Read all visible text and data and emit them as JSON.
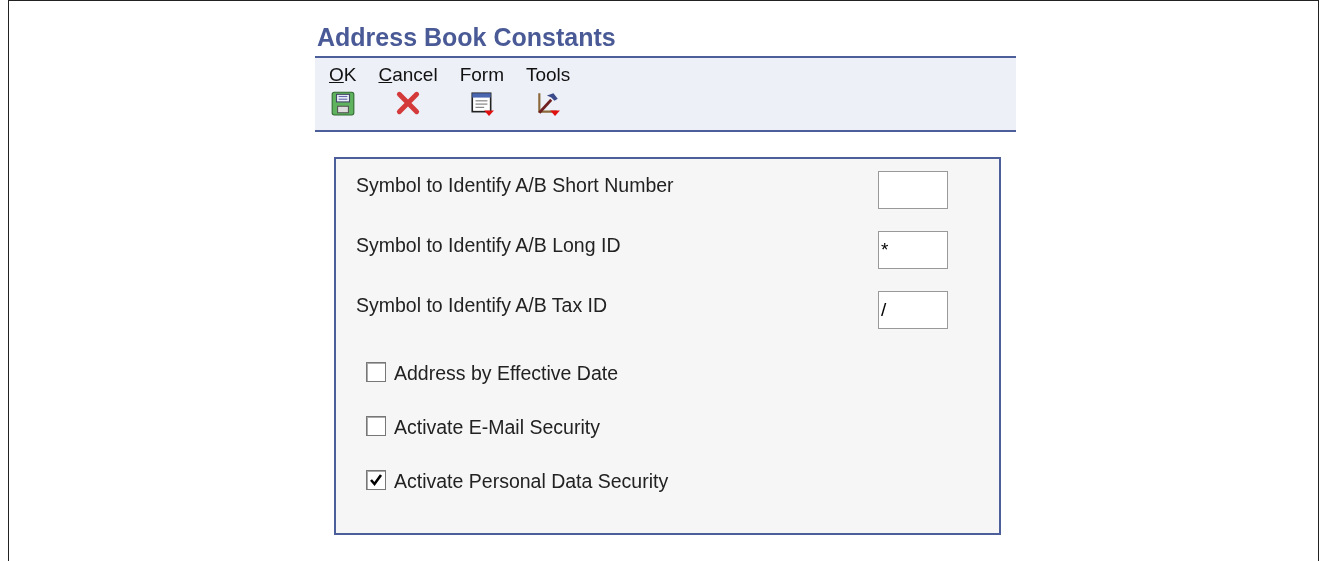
{
  "form": {
    "title": "Address Book Constants"
  },
  "toolbar": [
    {
      "label": "OK",
      "kind": "save"
    },
    {
      "label": "Cancel",
      "kind": "cancel"
    },
    {
      "label": "Form",
      "kind": "form"
    },
    {
      "label": "Tools",
      "kind": "tools"
    }
  ],
  "fields": [
    {
      "label": "Symbol to Identify A/B Short Number"
    },
    {
      "label": "Symbol to Identify A/B Long ID",
      "value": "*"
    },
    {
      "label": "Symbol to Identify A/B Tax ID",
      "value": "/"
    }
  ],
  "options": [
    {
      "label": "Address by Effective Date",
      "checked": false
    },
    {
      "label": "Activate E-Mail Security",
      "checked": false
    },
    {
      "label": "Activate Personal Data Security",
      "checked": true
    }
  ]
}
